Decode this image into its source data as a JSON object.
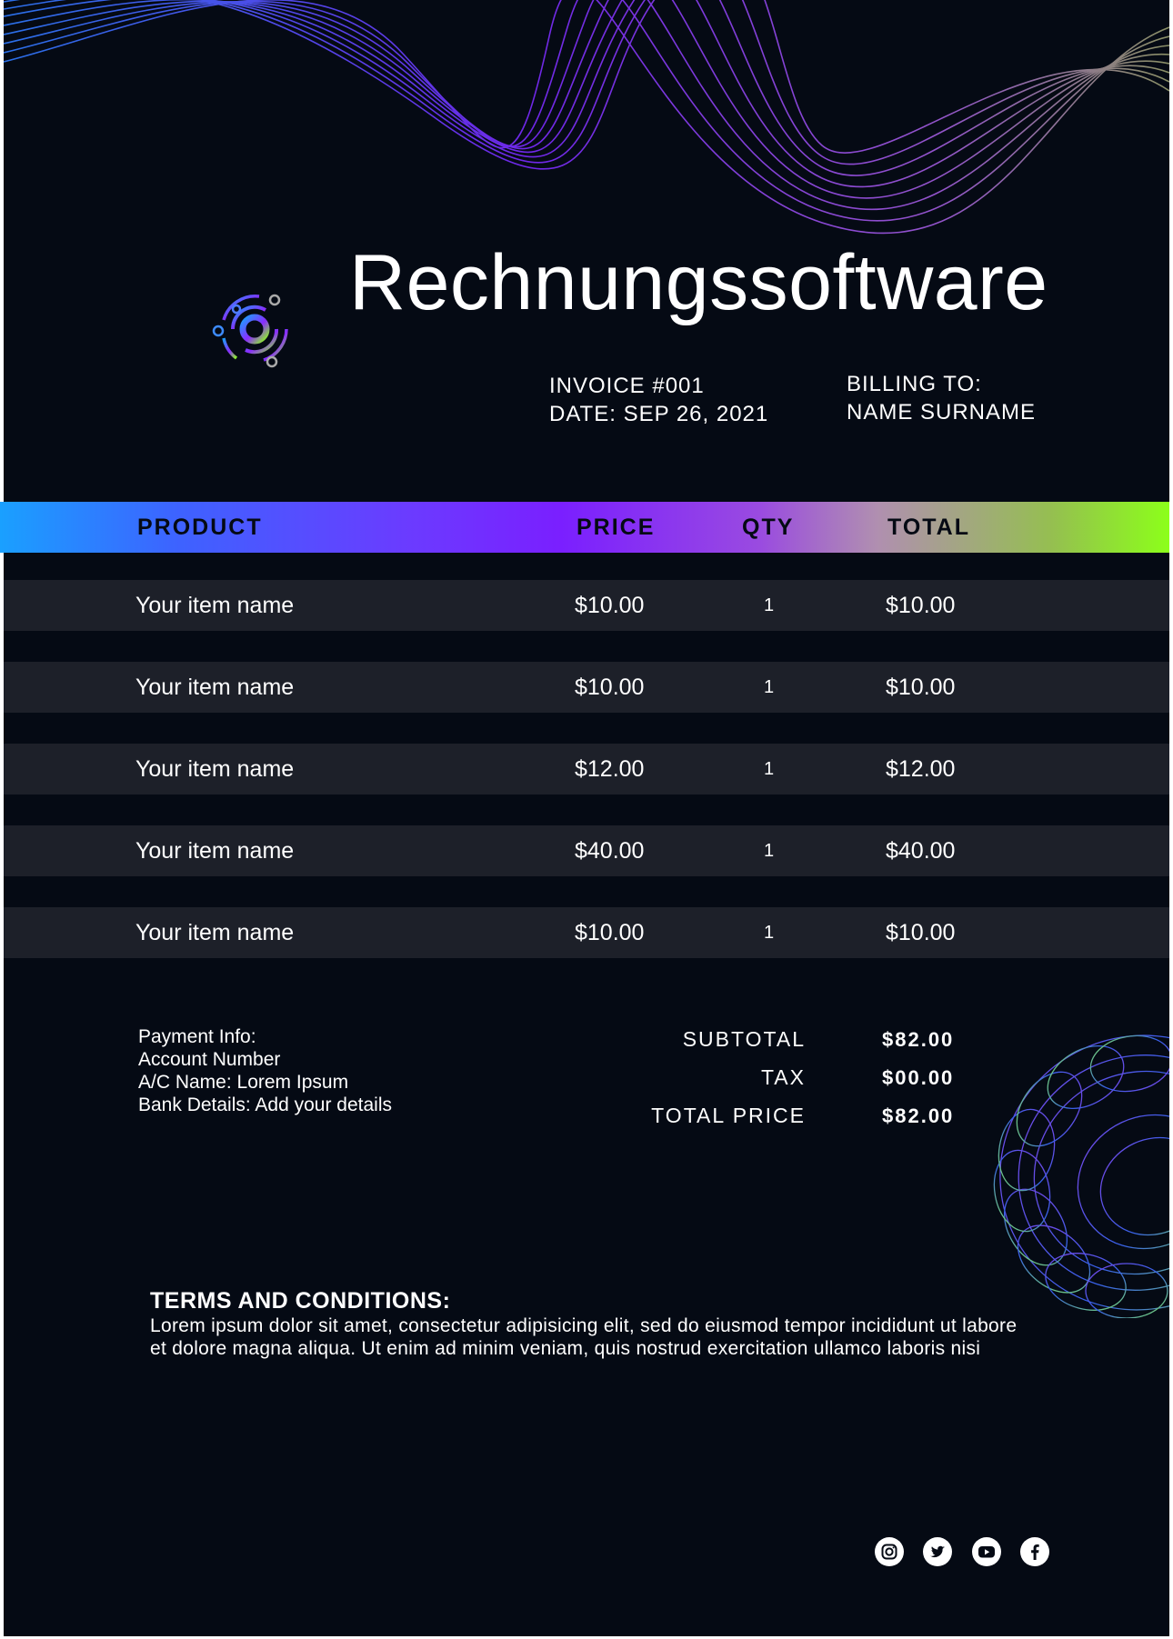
{
  "title": "Rechnungssoftware",
  "invoice": {
    "number": "INVOICE #001",
    "date": "DATE: SEP 26, 2021"
  },
  "billing": {
    "label": "BILLING TO:",
    "name": "NAME SURNAME"
  },
  "table": {
    "headers": [
      "PRODUCT",
      "PRICE",
      "QTY",
      "TOTAL"
    ],
    "rows": [
      {
        "name": "Your item name",
        "price": "$10.00",
        "qty": "1",
        "total": "$10.00"
      },
      {
        "name": "Your item name",
        "price": "$10.00",
        "qty": "1",
        "total": "$10.00"
      },
      {
        "name": "Your item name",
        "price": "$12.00",
        "qty": "1",
        "total": "$12.00"
      },
      {
        "name": "Your item name",
        "price": "$40.00",
        "qty": "1",
        "total": "$40.00"
      },
      {
        "name": "Your item name",
        "price": "$10.00",
        "qty": "1",
        "total": "$10.00"
      }
    ]
  },
  "payment": {
    "heading": "Payment Info:",
    "account": "Account Number",
    "ac_name": "A/C Name: Lorem Ipsum",
    "bank": "Bank Details: Add your details"
  },
  "summary": {
    "subtotal_label": "SUBTOTAL",
    "subtotal_value": "$82.00",
    "tax_label": "TAX",
    "tax_value": "$00.00",
    "total_label": "TOTAL PRICE",
    "total_value": "$82.00"
  },
  "terms": {
    "heading": "TERMS AND CONDITIONS:",
    "text": "Lorem ipsum dolor sit amet, consectetur adipisicing elit, sed do eiusmod tempor incididunt ut labore et dolore magna aliqua. Ut enim ad minim veniam, quis nostrud exercitation ullamco laboris nisi"
  },
  "social_icons": [
    "instagram-icon",
    "twitter-icon",
    "youtube-icon",
    "facebook-icon"
  ],
  "colors": {
    "background": "#050a14",
    "row": "#1d2029",
    "gradient_start": "#1aa0ff",
    "gradient_mid": "#7a1fff",
    "gradient_end": "#8cff1a"
  }
}
